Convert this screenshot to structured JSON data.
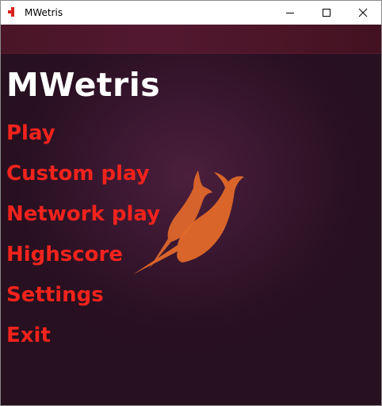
{
  "window": {
    "title": "MWetris",
    "controls": {
      "minimize_icon": "minimize-icon",
      "maximize_icon": "maximize-icon",
      "close_icon": "close-icon"
    }
  },
  "app": {
    "title": "MWetris",
    "logo_icon": "narwhal-logo-icon",
    "menu": [
      {
        "label": "Play"
      },
      {
        "label": "Custom play"
      },
      {
        "label": "Network play"
      },
      {
        "label": "Highscore"
      },
      {
        "label": "Settings"
      },
      {
        "label": "Exit"
      }
    ]
  },
  "colors": {
    "menu_text": "#f2231c",
    "title_text": "#ffffff",
    "background": "#3a1730",
    "top_band": "#4e162a",
    "logo": "#e2692a"
  }
}
